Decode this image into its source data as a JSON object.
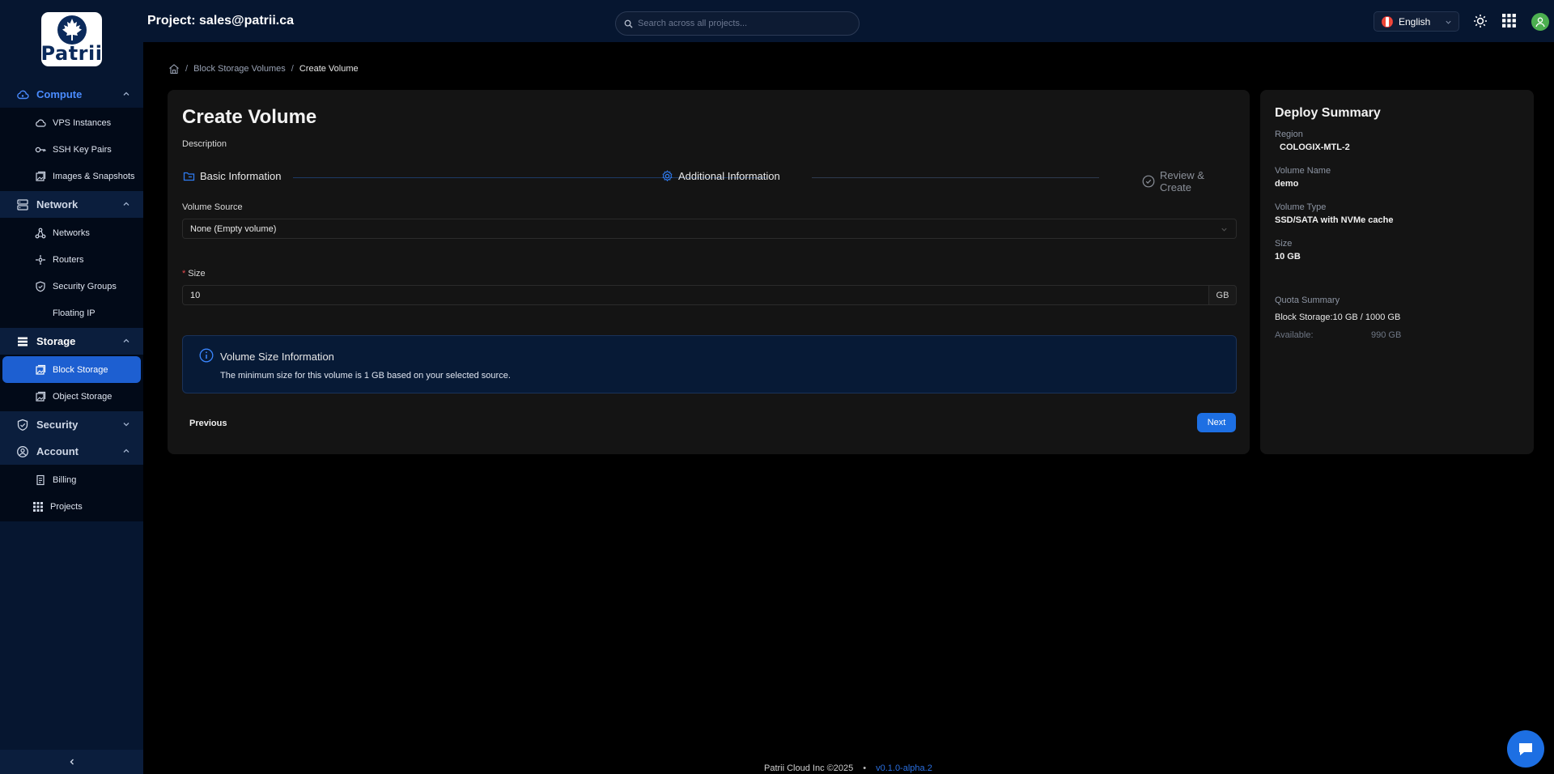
{
  "app": {
    "logo_text": "Patrii"
  },
  "header": {
    "project_title": "Project: sales@patrii.ca",
    "search_placeholder": "Search across all projects...",
    "language": "English"
  },
  "sidebar": {
    "groups": [
      {
        "label": "Compute",
        "items": [
          "VPS Instances",
          "SSH Key Pairs",
          "Images & Snapshots"
        ]
      },
      {
        "label": "Network",
        "items": [
          "Networks",
          "Routers",
          "Security Groups",
          "Floating IP"
        ]
      },
      {
        "label": "Storage",
        "items": [
          "Block Storage",
          "Object Storage"
        ]
      },
      {
        "label": "Security",
        "items": []
      },
      {
        "label": "Account",
        "items": [
          "Billing",
          "Projects"
        ]
      }
    ],
    "active_item": "Block Storage"
  },
  "breadcrumb": {
    "parent": "Block Storage Volumes",
    "current": "Create Volume"
  },
  "form": {
    "title": "Create Volume",
    "description": "Description",
    "steps": [
      "Basic Information",
      "Additional Information",
      "Review & Create"
    ],
    "volume_source_label": "Volume Source",
    "volume_source_value": "None (Empty volume)",
    "size_label": "Size",
    "size_value": "10",
    "size_unit": "GB",
    "info_title": "Volume Size Information",
    "info_text": "The minimum size for this volume is 1 GB based on your selected source.",
    "previous_label": "Previous",
    "next_label": "Next"
  },
  "summary": {
    "title": "Deploy Summary",
    "region_label": "Region",
    "region_value": "COLOGIX-MTL-2",
    "name_label": "Volume Name",
    "name_value": "demo",
    "type_label": "Volume Type",
    "type_value": "SSD/SATA with NVMe cache",
    "size_label": "Size",
    "size_value": "10 GB",
    "quota_title": "Quota Summary",
    "quota_line": "Block Storage:10 GB / 1000 GB",
    "available_label": "Available:",
    "available_value": "990 GB"
  },
  "footer": {
    "copyright": "Patrii Cloud Inc ©2025",
    "version": "v0.1.0-alpha.2"
  },
  "colors": {
    "accent": "#1d6fe3",
    "sidebar_bg": "#061630",
    "success": "#4caf50"
  }
}
